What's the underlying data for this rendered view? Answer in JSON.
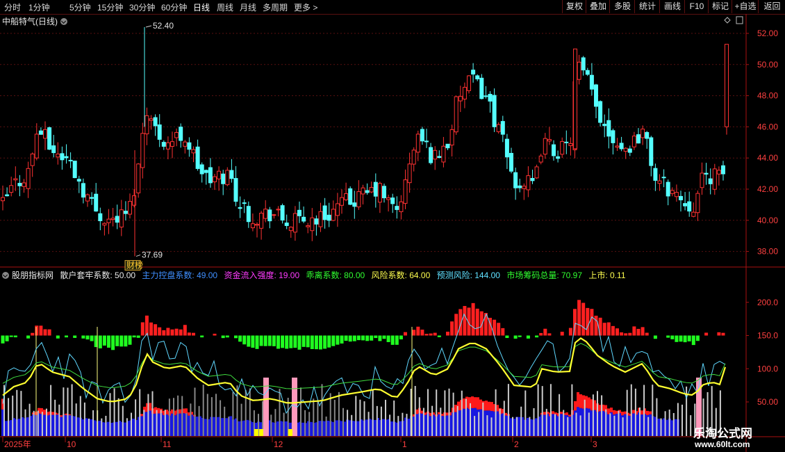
{
  "toolbar": {
    "tabs": [
      "分时",
      "1分钟",
      "5分钟",
      "15分钟",
      "30分钟",
      "60分钟",
      "日线",
      "周线",
      "月线",
      "多周期",
      "更多 >"
    ],
    "active": "日线",
    "right_buttons": [
      "复权",
      "叠加",
      "多股",
      "统计",
      "画线",
      "F10",
      "标记",
      "+自选",
      "返回"
    ]
  },
  "main_chart": {
    "title": "中船特气(日线)",
    "price_axis": [
      "52.00",
      "50.00",
      "48.00",
      "46.00",
      "44.00",
      "42.00",
      "40.00",
      "38.00"
    ],
    "high_label": "52.40",
    "low_label": "37.69",
    "badge": "财榜",
    "colors": {
      "up": "#ff3232",
      "down": "#54ffff",
      "axis": "#aa1111",
      "grid": "#5a1010"
    }
  },
  "indicator": {
    "name": "股朋指标网",
    "items": [
      {
        "label": "散户套牢系数: 50.00",
        "color": "#e8e8e8"
      },
      {
        "label": "主力控盘系数: 49.00",
        "color": "#3f8fff"
      },
      {
        "label": "资金流入强度: 19.00",
        "color": "#ff3cff"
      },
      {
        "label": "乖离系数: 80.00",
        "color": "#30ff30"
      },
      {
        "label": "风险系数: 64.00",
        "color": "#ffff50"
      },
      {
        "label": "预测风险: 144.00",
        "color": "#60e0ff"
      },
      {
        "label": "市场筹码总量: 70.97",
        "color": "#30ff30"
      },
      {
        "label": "上市: 0.11",
        "color": "#ffff50"
      }
    ],
    "axis": [
      "200.0",
      "150.0",
      "100.0",
      "50.00"
    ]
  },
  "date_axis": [
    "2025年",
    "10",
    "11",
    "12",
    "1",
    "2",
    "3"
  ],
  "watermark": {
    "line1": "乐淘公式网",
    "line2": "www.60lt.com"
  }
}
